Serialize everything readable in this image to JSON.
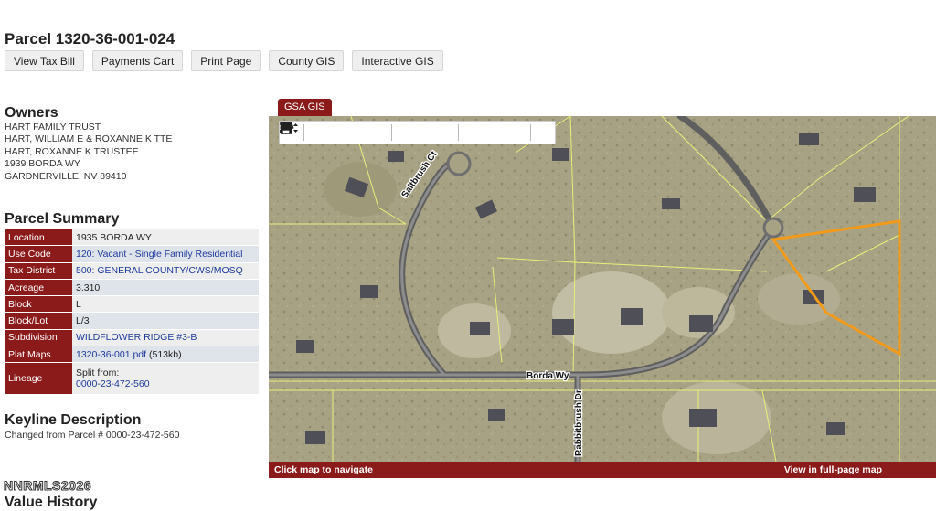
{
  "title": "Parcel 1320-36-001-024",
  "buttons": [
    "View Tax Bill",
    "Payments Cart",
    "Print Page",
    "County GIS",
    "Interactive GIS"
  ],
  "owners": {
    "heading": "Owners",
    "lines": [
      "HART FAMILY TRUST",
      "HART, WILLIAM E & ROXANNE K TTE",
      "HART, ROXANNE K TRUSTEE",
      "1939 BORDA WY",
      "GARDNERVILLE, NV 89410"
    ]
  },
  "summary": {
    "heading": "Parcel Summary",
    "rows": {
      "location": {
        "label": "Location",
        "value": "1935 BORDA WY"
      },
      "use_code": {
        "label": "Use Code",
        "value": "120: Vacant - Single Family Residential"
      },
      "tax_district": {
        "label": "Tax District",
        "value": "500: GENERAL COUNTY/CWS/MOSQ"
      },
      "acreage": {
        "label": "Acreage",
        "value": "3.310"
      },
      "block": {
        "label": "Block",
        "value": "L"
      },
      "block_lot": {
        "label": "Block/Lot",
        "value": "L/3"
      },
      "subdivision": {
        "label": "Subdivision",
        "value": "WILDFLOWER RIDGE #3-B"
      },
      "plat_maps": {
        "label": "Plat Maps",
        "link": "1320-36-001.pdf",
        "size": "(513kb)"
      },
      "lineage": {
        "label": "Lineage",
        "text": "Split from:",
        "link": "0000-23-472-560"
      }
    }
  },
  "keyline": {
    "heading": "Keyline Description",
    "text": "Changed from Parcel # 0000-23-472-560"
  },
  "watermark": "NNRMLS2026",
  "value_history": {
    "heading": "Value History"
  },
  "gis": {
    "tab": "GSA GIS",
    "streets": {
      "saltbrush": "Saltbrush Ct",
      "borda": "Borda Wy",
      "rabbitbrush": "Rabbitbrush Dr"
    },
    "footer_left": "Click map to navigate",
    "footer_right": "View in full-page map",
    "colors": {
      "parcel_highlight": "#f29a1a",
      "parcel_lines": "#e8ef7a",
      "road": "#6f6f6f",
      "brand": "#8b1b1b"
    },
    "tools": [
      "layers-icon",
      "zoom-out-icon",
      "zoom-extent-icon",
      "zoom-in-icon",
      "target-icon",
      "measure-distance-icon",
      "measure-area-icon",
      "eraser-icon",
      "fullscreen-icon",
      "download-icon",
      "select-icon",
      "print-icon"
    ]
  }
}
